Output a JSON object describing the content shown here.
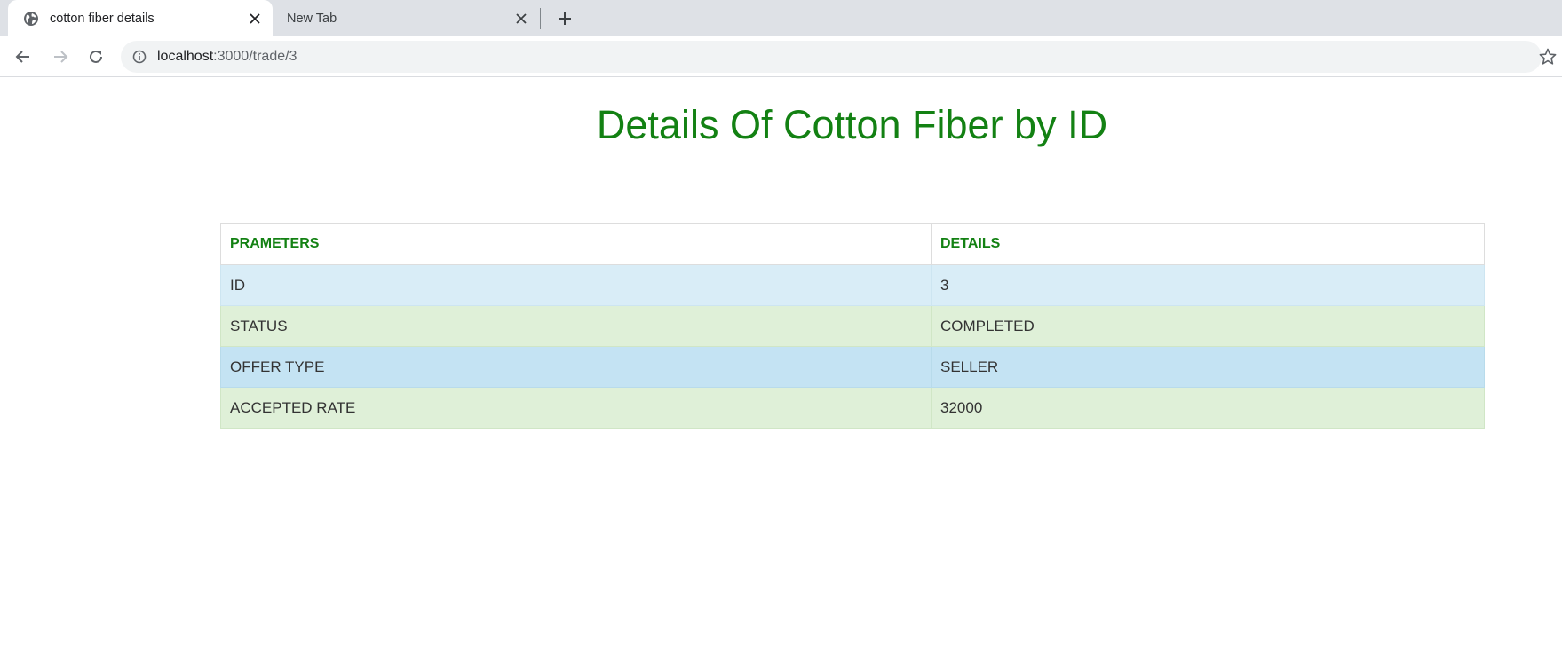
{
  "browser": {
    "tabs": [
      {
        "title": "cotton fiber details",
        "active": true,
        "icon": "globe-icon"
      },
      {
        "title": "New Tab",
        "active": false
      }
    ],
    "url": {
      "host": "localhost",
      "path": ":3000/trade/3"
    }
  },
  "page": {
    "heading": "Details Of Cotton Fiber by ID",
    "table": {
      "headers": [
        "PRAMETERS",
        "DETAILS"
      ],
      "rows": [
        {
          "param": "ID",
          "value": "3"
        },
        {
          "param": "STATUS",
          "value": "COMPLETED"
        },
        {
          "param": "OFFER TYPE",
          "value": "SELLER"
        },
        {
          "param": "ACCEPTED RATE",
          "value": "32000"
        }
      ]
    }
  },
  "colors": {
    "heading": "#138113",
    "row_info": "#d9edf7",
    "row_success": "#dff0d8",
    "row_active": "#c4e3f3",
    "chrome_bg": "#dee1e6"
  }
}
